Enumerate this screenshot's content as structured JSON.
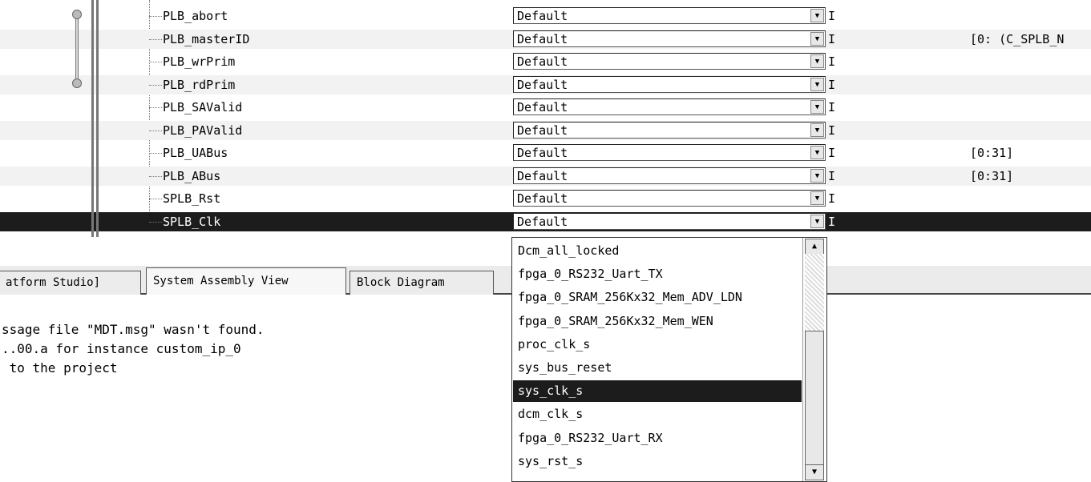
{
  "ports": [
    {
      "name": "PLB_abort",
      "net": "Default",
      "dir": "I",
      "range": ""
    },
    {
      "name": "PLB_masterID",
      "net": "Default",
      "dir": "I",
      "range": "[0: (C_SPLB_N"
    },
    {
      "name": "PLB_wrPrim",
      "net": "Default",
      "dir": "I",
      "range": ""
    },
    {
      "name": "PLB_rdPrim",
      "net": "Default",
      "dir": "I",
      "range": ""
    },
    {
      "name": "PLB_SAValid",
      "net": "Default",
      "dir": "I",
      "range": ""
    },
    {
      "name": "PLB_PAValid",
      "net": "Default",
      "dir": "I",
      "range": ""
    },
    {
      "name": "PLB_UABus",
      "net": "Default",
      "dir": "I",
      "range": "[0:31]"
    },
    {
      "name": "PLB_ABus",
      "net": "Default",
      "dir": "I",
      "range": "[0:31]"
    },
    {
      "name": "SPLB_Rst",
      "net": "Default",
      "dir": "I",
      "range": ""
    },
    {
      "name": "SPLB_Clk",
      "net": "Default",
      "dir": "I",
      "range": ""
    }
  ],
  "selected_port": "SPLB_Clk",
  "tabs": [
    {
      "label": "atform Studio]"
    },
    {
      "label": "System Assembly View"
    },
    {
      "label": "Block Diagram"
    }
  ],
  "active_tab": "System Assembly View",
  "console_lines": [
    "ssage file \"MDT.msg\" wasn't found.",
    "..00.a for instance custom_ip_0",
    " to the project"
  ],
  "dropdown_options": [
    "Dcm_all_locked",
    "fpga_0_RS232_Uart_TX",
    "fpga_0_SRAM_256Kx32_Mem_ADV_LDN",
    "fpga_0_SRAM_256Kx32_Mem_WEN",
    "proc_clk_s",
    "sys_bus_reset",
    "sys_clk_s",
    "dcm_clk_s",
    "fpga_0_RS232_Uart_RX",
    "sys_rst_s"
  ],
  "highlighted_option": "sys_clk_s",
  "icons": {
    "dropdown_arrow": "chevron-down-icon",
    "scroll_left": "arrow-left-icon",
    "scroll_right": "arrow-right-icon",
    "scroll_up": "arrow-up-icon",
    "scroll_down": "arrow-down-icon"
  },
  "colors": {
    "selection": "#1c1c1c",
    "alt_row": "#f2f2f2"
  }
}
